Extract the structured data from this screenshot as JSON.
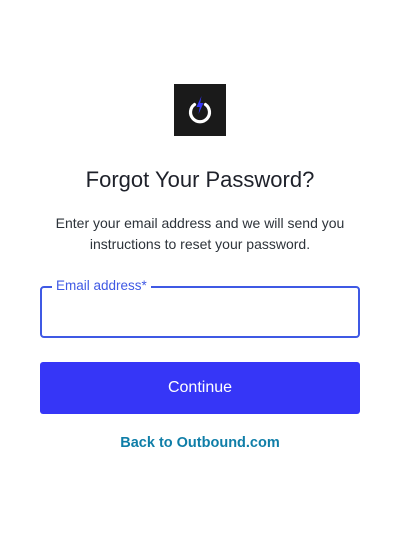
{
  "logo": {
    "icon": "power-bolt-icon",
    "background_color": "#1a1a1a",
    "bolt_color": "#3636f7"
  },
  "page": {
    "title": "Forgot Your Password?",
    "description": "Enter your email address and we will send you instructions to reset your password."
  },
  "form": {
    "email_label": "Email address*",
    "email_value": "",
    "email_placeholder": "",
    "continue_label": "Continue"
  },
  "footer": {
    "back_link_label": "Back to Outbound.com"
  },
  "colors": {
    "accent": "#3636f7",
    "field_border": "#3f59e4",
    "link": "#0f7ea8",
    "text": "#1e212a"
  }
}
